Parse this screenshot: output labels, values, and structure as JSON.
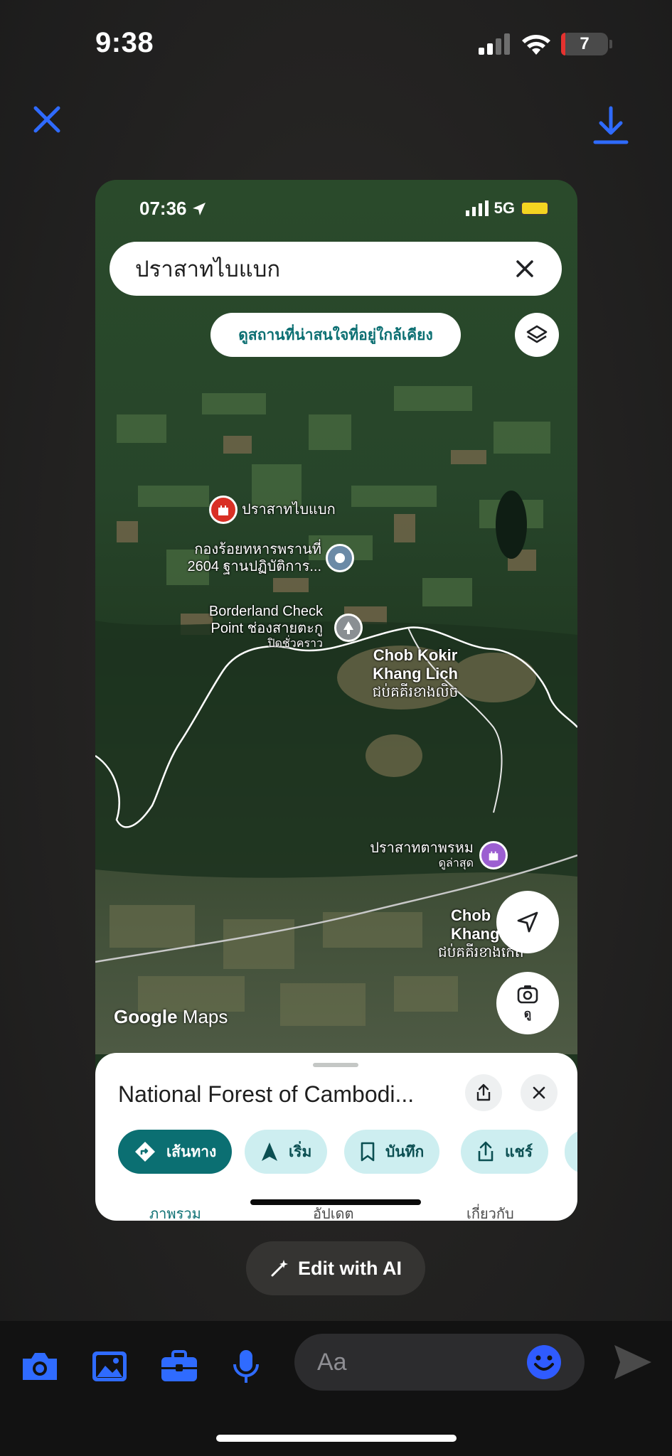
{
  "status_bar": {
    "time": "9:38",
    "battery_level": "7"
  },
  "top_bar": {
    "close_icon": "close-icon",
    "download_icon": "download-icon"
  },
  "screenshot": {
    "status": {
      "time": "07:36",
      "network": "5G"
    },
    "search": {
      "query": "ปราสาทไบแบก"
    },
    "nearby_button": "ดูสถานที่น่าสนใจที่อยู่ใกล้เคียง",
    "places": [
      {
        "name": "ปราสาทไบแบก"
      },
      {
        "line1": "กองร้อยทหารพรานที่",
        "line2": "2604 ฐานปฏิบัติการ..."
      },
      {
        "line1": "Borderland Check",
        "line2": "Point ช่องสายตะกู",
        "line3": "ปิดชั่วคราว"
      },
      {
        "line1": "Chob Kokir",
        "line2": "Khang Lich",
        "line3": "ជប់គគីរខាងលិច"
      },
      {
        "line1": "ปราสาทตาพรหม",
        "line2": "ดูล่าสุด"
      },
      {
        "line1": "Chob",
        "line2": "Khang",
        "line3": "ជប់គគីរខាងកើត"
      }
    ],
    "lens_label": "ดู",
    "logo": {
      "google": "Google",
      "maps": "Maps"
    },
    "sheet": {
      "title": "National Forest of Cambodi...",
      "chips": [
        "เส้นทาง",
        "เริ่ม",
        "บันทึก",
        "แชร์"
      ],
      "tabs": [
        "ภาพรวม",
        "อัปเดต",
        "เกี่ยวกับ"
      ]
    }
  },
  "edit_ai": {
    "label": "Edit with AI"
  },
  "composer": {
    "placeholder": "Aa"
  },
  "colors": {
    "accent": "#2f5bff",
    "maps_teal": "#0b6f72",
    "chip_bg": "#cdeef0"
  }
}
